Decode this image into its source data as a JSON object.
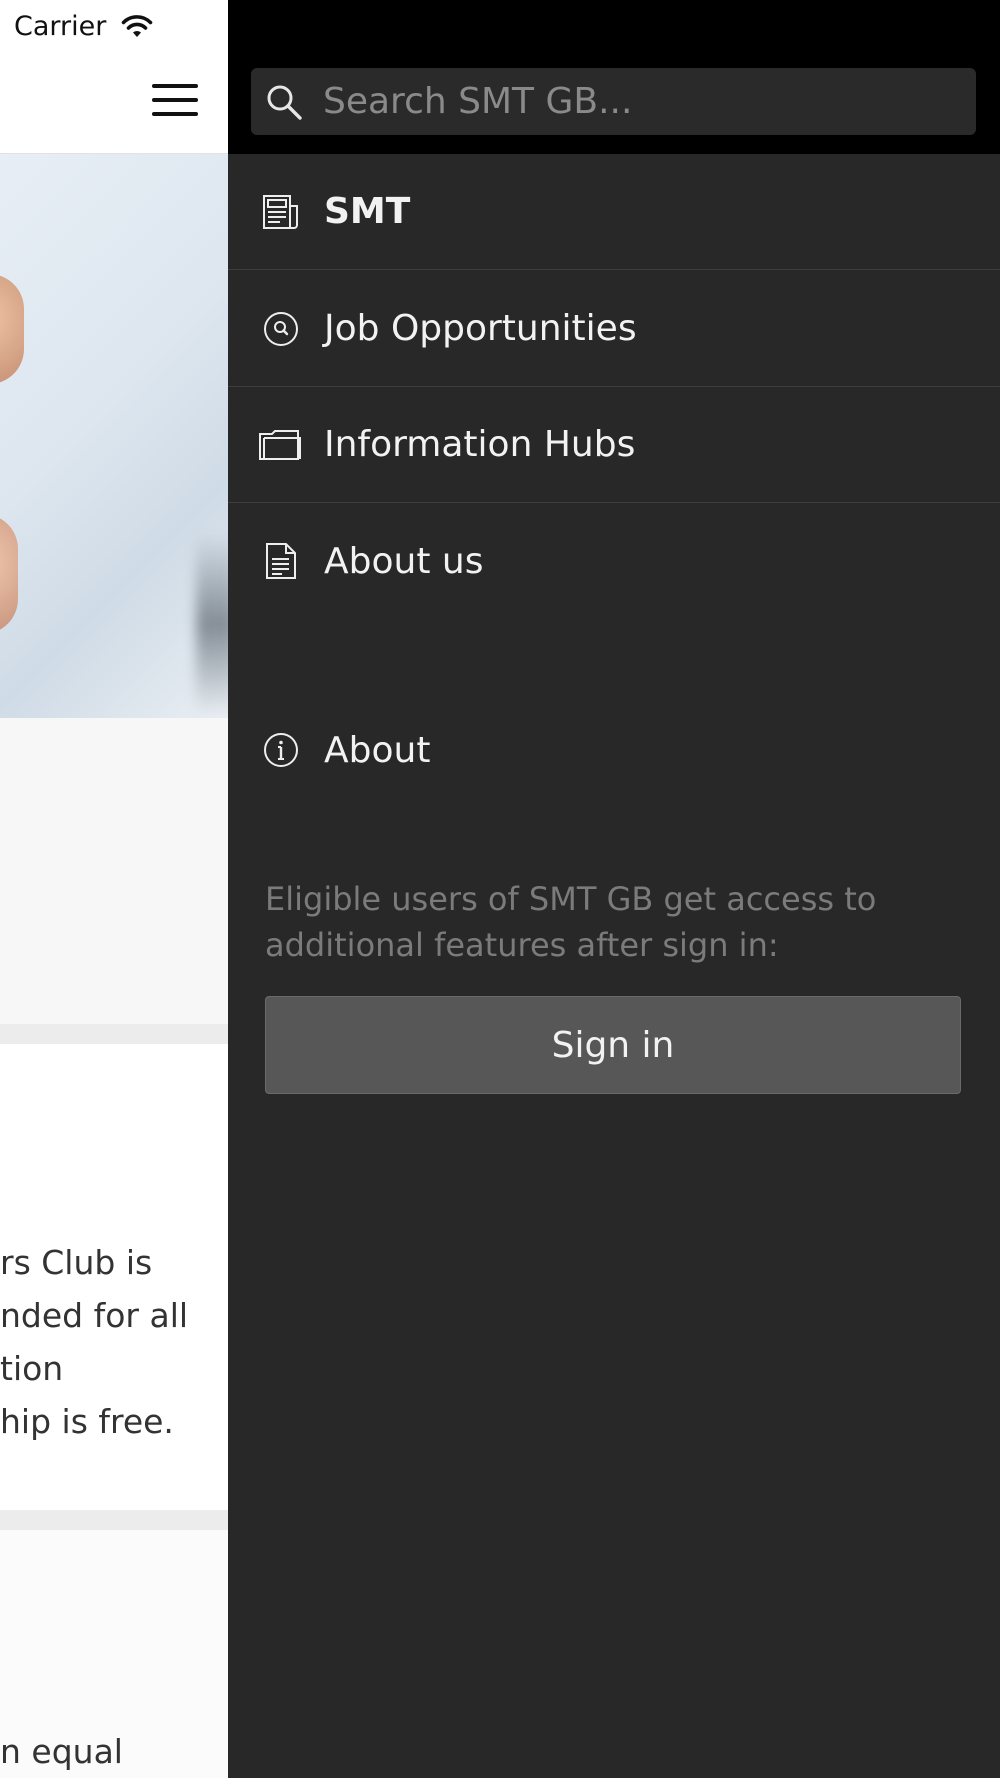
{
  "status_bar": {
    "carrier": "Carrier"
  },
  "background_page": {
    "text_lines": [
      "rs Club is",
      "nded for all",
      "tion",
      "hip is free.",
      "n equal"
    ]
  },
  "drawer": {
    "search": {
      "placeholder": "Search SMT GB...",
      "value": ""
    },
    "nav_items": [
      {
        "label": "SMT",
        "icon": "news-icon",
        "active": true
      },
      {
        "label": "Job Opportunities",
        "icon": "search-circle-icon"
      },
      {
        "label": "Information Hubs",
        "icon": "folder-icon"
      },
      {
        "label": "About us",
        "icon": "document-icon"
      }
    ],
    "about": {
      "label": "About",
      "icon": "info-icon"
    },
    "eligible_text": "Eligible users of SMT GB get access to additional features after sign in:",
    "signin_label": "Sign in"
  },
  "colors": {
    "drawer_bg": "#282828",
    "drawer_header_bg": "#000000",
    "button_bg": "#575757",
    "muted_text": "#7b7b7b"
  }
}
